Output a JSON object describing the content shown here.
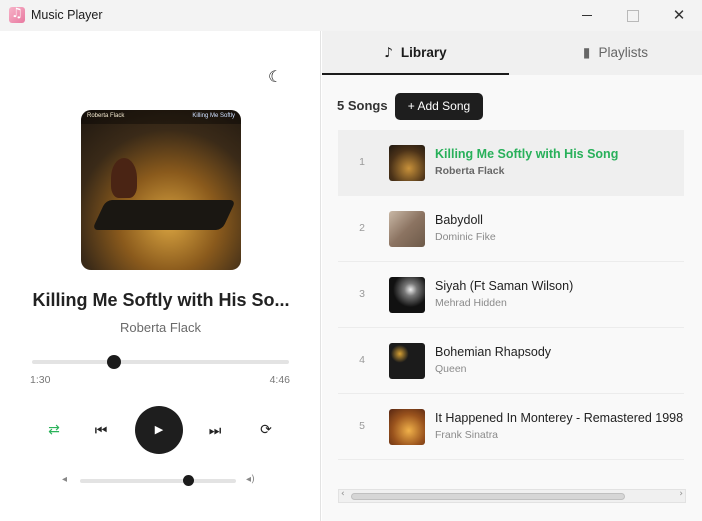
{
  "window": {
    "title": "Music Player",
    "minimize_icon": "minimize-icon",
    "maximize_icon": "maximize-icon",
    "close_glyph": "✕"
  },
  "theme": {
    "accent": "#28b05a",
    "dark": "#1e1e1e",
    "toggle_glyph": "☾"
  },
  "now_playing": {
    "title": "Killing Me Softly with His So...",
    "artist": "Roberta Flack",
    "art_left_text": "Roberta Flack",
    "art_right_text": "Killing Me Softly",
    "current_time": "1:30",
    "total_time": "4:46",
    "progress_fraction": 0.318,
    "volume_fraction": 0.69
  },
  "controls": {
    "shuffle_glyph": "⇄",
    "prev_glyph": "⏮",
    "play_glyph": "▶",
    "next_glyph": "⏭",
    "repeat_glyph": "⟳",
    "volume_low_glyph": "◂",
    "volume_high_glyph": "◂)"
  },
  "tabs": {
    "library": {
      "label": "Library",
      "icon": "♪"
    },
    "playlists": {
      "label": "Playlists",
      "icon": "▮"
    }
  },
  "library": {
    "count_label": "5 Songs",
    "add_button_label": "+ Add Song",
    "songs": [
      {
        "num": "1",
        "title": "Killing Me Softly with His Song",
        "artist": "Roberta Flack",
        "active": true
      },
      {
        "num": "2",
        "title": "Babydoll",
        "artist": "Dominic Fike",
        "active": false
      },
      {
        "num": "3",
        "title": "Siyah (Ft Saman Wilson)",
        "artist": "Mehrad Hidden",
        "active": false
      },
      {
        "num": "4",
        "title": "Bohemian Rhapsody",
        "artist": "Queen",
        "active": false
      },
      {
        "num": "5",
        "title": "It Happened In Monterey - Remastered 1998",
        "artist": "Frank Sinatra",
        "active": false
      }
    ]
  },
  "scrollbar": {
    "left_glyph": "‹",
    "right_glyph": "›"
  }
}
